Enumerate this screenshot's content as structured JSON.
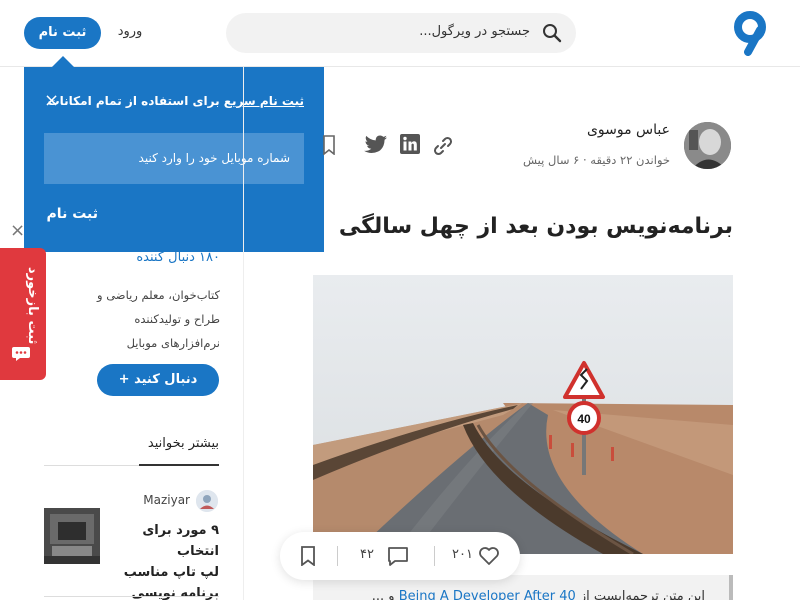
{
  "header": {
    "search_placeholder": "جستجو در ویرگول...",
    "login_label": "ورود",
    "signup_label": "ثبت نام",
    "brand_color": "#1a76c5"
  },
  "popup": {
    "title_link": "ثبت نام سریع",
    "title_rest": " برای استفاده از تمام امکانات",
    "close_icon": "×",
    "input_placeholder": "شماره موبایل خود را وارد کنید",
    "submit_label": "ثبت نام"
  },
  "feedback": {
    "label": "ثبت بازخورد",
    "color": "#e0393e"
  },
  "sidebar": {
    "close_icon": "×",
    "followers": "۱۸۰ دنبال کننده",
    "bio_lines": [
      "کتاب‌خوان، معلم ریاضی و",
      "طراح و تولیدکننده",
      "نرم‌افزارهای موبایل"
    ],
    "follow_label": "دنبال کنید +",
    "more_heading": "بیشتر بخوانید",
    "recommend": {
      "author": "Maziyar",
      "title_lines": [
        "۹ مورد برای انتخاب",
        "لپ تاپ مناسب",
        "برنامه نویسی"
      ]
    }
  },
  "article": {
    "author": "عباس موسوی",
    "meta": "خواندن ۲۲ دقیقه · ۶ سال پیش",
    "title": "برنامه‌نویس بودن بعد از چهل سالگی",
    "quote_prefix": "این متن ترجمه‌ایست از ",
    "quote_link": "Being A Developer After 40",
    "quote_suffix": " و ..."
  },
  "action_bar": {
    "comments": "۴۲",
    "likes": "۲۰۱"
  }
}
